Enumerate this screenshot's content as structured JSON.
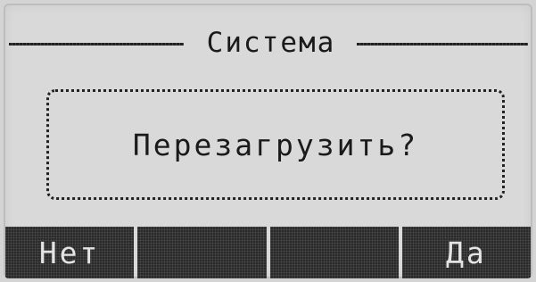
{
  "screen": {
    "title": "Система",
    "dialog": {
      "message": "Перезагрузить?"
    },
    "softkeys": [
      {
        "label": "Нет"
      },
      {
        "label": ""
      },
      {
        "label": ""
      },
      {
        "label": "Да"
      }
    ]
  }
}
